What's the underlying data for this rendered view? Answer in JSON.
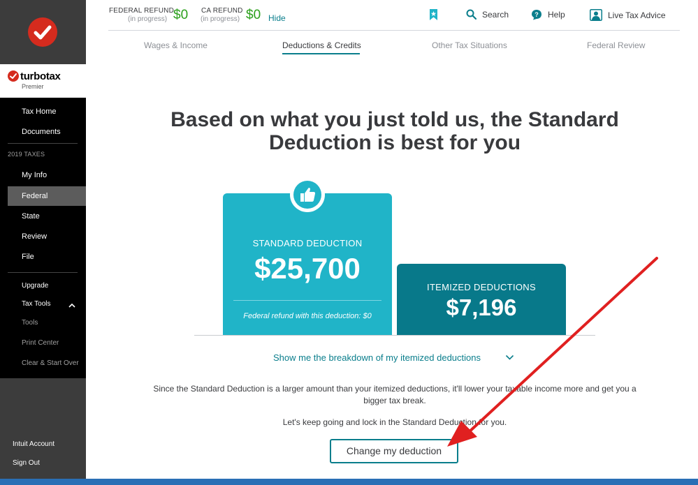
{
  "sidebar": {
    "brand_name": "turbotax",
    "brand_edition": "Premier",
    "tax_home": "Tax Home",
    "documents": "Documents",
    "section_taxes": "2019 TAXES",
    "my_info": "My Info",
    "federal": "Federal",
    "state": "State",
    "review": "Review",
    "file": "File",
    "upgrade": "Upgrade",
    "tax_tools": "Tax Tools",
    "tools": "Tools",
    "print_center": "Print Center",
    "clear_start_over": "Clear & Start Over",
    "intuit_account": "Intuit Account",
    "sign_out": "Sign Out"
  },
  "header": {
    "federal_refund_label": "FEDERAL REFUND",
    "federal_refund_sub": "(in progress)",
    "federal_refund_amount": "$0",
    "ca_refund_label": "CA REFUND",
    "ca_refund_sub": "(in progress)",
    "ca_refund_amount": "$0",
    "hide": "Hide",
    "search": "Search",
    "help": "Help",
    "live_tax_advice": "Live Tax Advice"
  },
  "tabs": [
    {
      "label": "Wages & Income",
      "active": false
    },
    {
      "label": "Deductions & Credits",
      "active": true
    },
    {
      "label": "Other Tax Situations",
      "active": false
    },
    {
      "label": "Federal Review",
      "active": false
    }
  ],
  "main": {
    "headline": "Based on what you just told us, the Standard Deduction is best for you",
    "standard": {
      "title": "STANDARD DEDUCTION",
      "amount": "$25,700",
      "note": "Federal refund with this deduction: $0"
    },
    "itemized": {
      "title": "ITEMIZED DEDUCTIONS",
      "amount": "$7,196"
    },
    "breakdown_link": "Show me the breakdown of my itemized deductions",
    "explanation": "Since the Standard Deduction is a larger amount than your itemized deductions, it'll lower your taxable income more and get you a bigger tax break.",
    "lockin_prefix": "Let's keep going and lock in the ",
    "lockin_strong": "Standard Deduction",
    "lockin_suffix": " for you.",
    "change_button": "Change my deduction"
  },
  "colors": {
    "standard_card": "#20b4c8",
    "itemized_card": "#08798a",
    "accent": "#0a7e8c",
    "refund_green": "#2ca01c",
    "annotation_arrow": "#e02020"
  }
}
